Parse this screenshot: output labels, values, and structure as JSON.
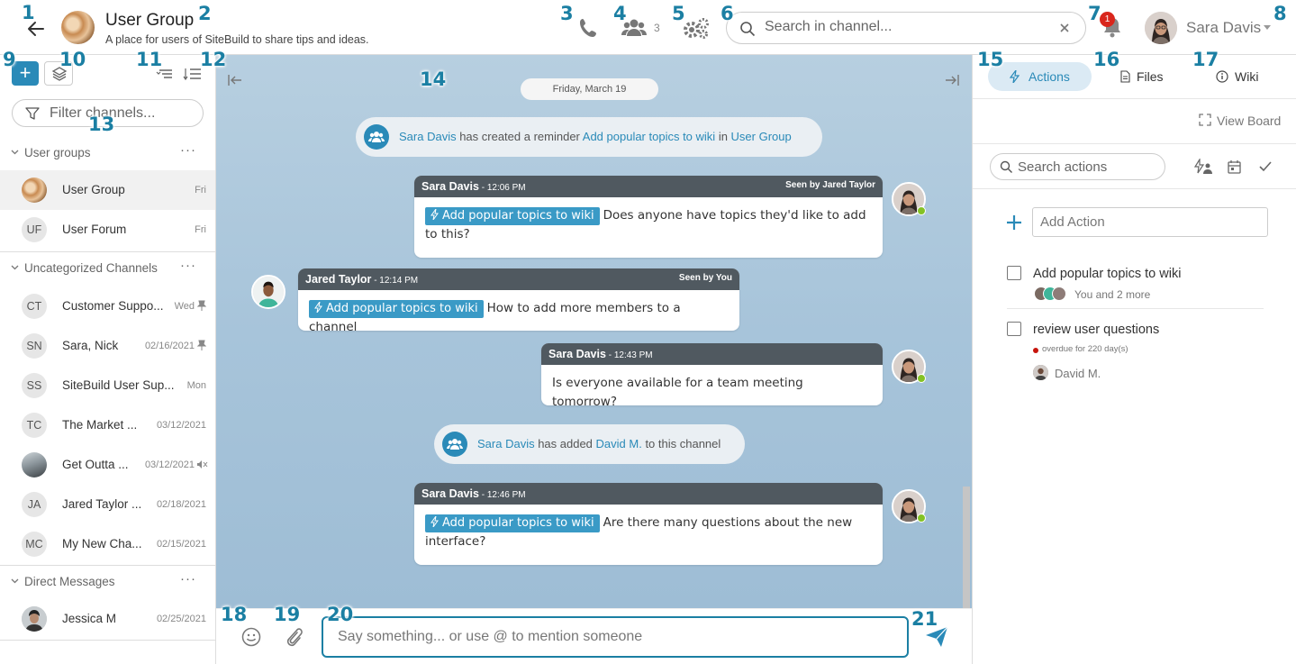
{
  "header": {
    "group_name": "User Group",
    "group_desc": "A place for users of SiteBuild to share tips and ideas.",
    "member_count": "3",
    "search_placeholder": "Search in channel...",
    "notif_count": "1",
    "user_name": "Sara Davis"
  },
  "numbers": [
    "1",
    "2",
    "3",
    "4",
    "5",
    "6",
    "7",
    "8",
    "9",
    "10",
    "11",
    "12",
    "13",
    "14",
    "15",
    "16",
    "17",
    "18",
    "19",
    "20",
    "21"
  ],
  "sidebar": {
    "filter_placeholder": "Filter channels...",
    "sections": [
      {
        "label": "User groups"
      },
      {
        "label": "Uncategorized Channels"
      },
      {
        "label": "Direct Messages"
      }
    ],
    "user_groups": [
      {
        "name": "User Group",
        "date": "Fri"
      },
      {
        "initials": "UF",
        "name": "User Forum",
        "date": "Fri"
      }
    ],
    "channels": [
      {
        "initials": "CT",
        "name": "Customer Suppo...",
        "date": "Wed"
      },
      {
        "initials": "SN",
        "name": "Sara, Nick",
        "date": "02/16/2021"
      },
      {
        "initials": "SS",
        "name": "SiteBuild User Sup...",
        "date": "Mon"
      },
      {
        "initials": "TC",
        "name": "The Market ...",
        "date": "03/12/2021"
      },
      {
        "name": "Get Outta ...",
        "date": "03/12/2021"
      },
      {
        "initials": "JA",
        "name": "Jared Taylor ...",
        "date": "02/18/2021"
      },
      {
        "initials": "MC",
        "name": "My New Cha...",
        "date": "02/15/2021"
      }
    ],
    "dms": [
      {
        "name": "Jessica M",
        "date": "02/25/2021"
      }
    ]
  },
  "chat": {
    "date_divider": "Friday, March 19",
    "sys1": {
      "user": "Sara Davis",
      "text1": " has created a reminder ",
      "link": "Add popular topics to wiki",
      "text2": " in ",
      "channel": "User Group"
    },
    "sys2": {
      "user": "Sara Davis",
      "text1": " has added ",
      "link": "David M.",
      "text2": " to this channel"
    },
    "messages": [
      {
        "author": "Sara Davis",
        "time": " - 12:06 PM",
        "seen": "Seen by Jared Taylor",
        "tag": "Add popular topics to wiki",
        "text": "Does anyone have topics they'd like to add to this?"
      },
      {
        "author": "Jared Taylor",
        "time": " - 12:14 PM",
        "seen": "Seen by You",
        "tag": "Add popular topics to wiki",
        "text": "How to add more members to a channel"
      },
      {
        "author": "Sara Davis",
        "time": " - 12:43 PM",
        "seen": "",
        "tag": "",
        "text": "Is everyone available for a team meeting tomorrow?"
      },
      {
        "author": "Sara Davis",
        "time": " - 12:46 PM",
        "seen": "",
        "tag": "Add popular topics to wiki",
        "text": "Are there many questions about the new interface?"
      }
    ],
    "composer_placeholder": "Say something... or use @ to mention someone"
  },
  "right": {
    "tabs": [
      {
        "label": "Actions"
      },
      {
        "label": "Files"
      },
      {
        "label": "Wiki"
      }
    ],
    "view_board": "View Board",
    "search_placeholder": "Search actions",
    "add_placeholder": "Add Action",
    "actions": [
      {
        "title": "Add popular topics to wiki",
        "meta": "You and 2 more"
      },
      {
        "title": "review user questions",
        "overdue": "overdue for 220 day(s)",
        "assignee": "David M."
      }
    ]
  },
  "colors": {
    "accent": "#2a8ab8",
    "number": "#1b7fa3",
    "header_bar": "#505960",
    "online": "#84c225",
    "badge": "#d9261c"
  }
}
